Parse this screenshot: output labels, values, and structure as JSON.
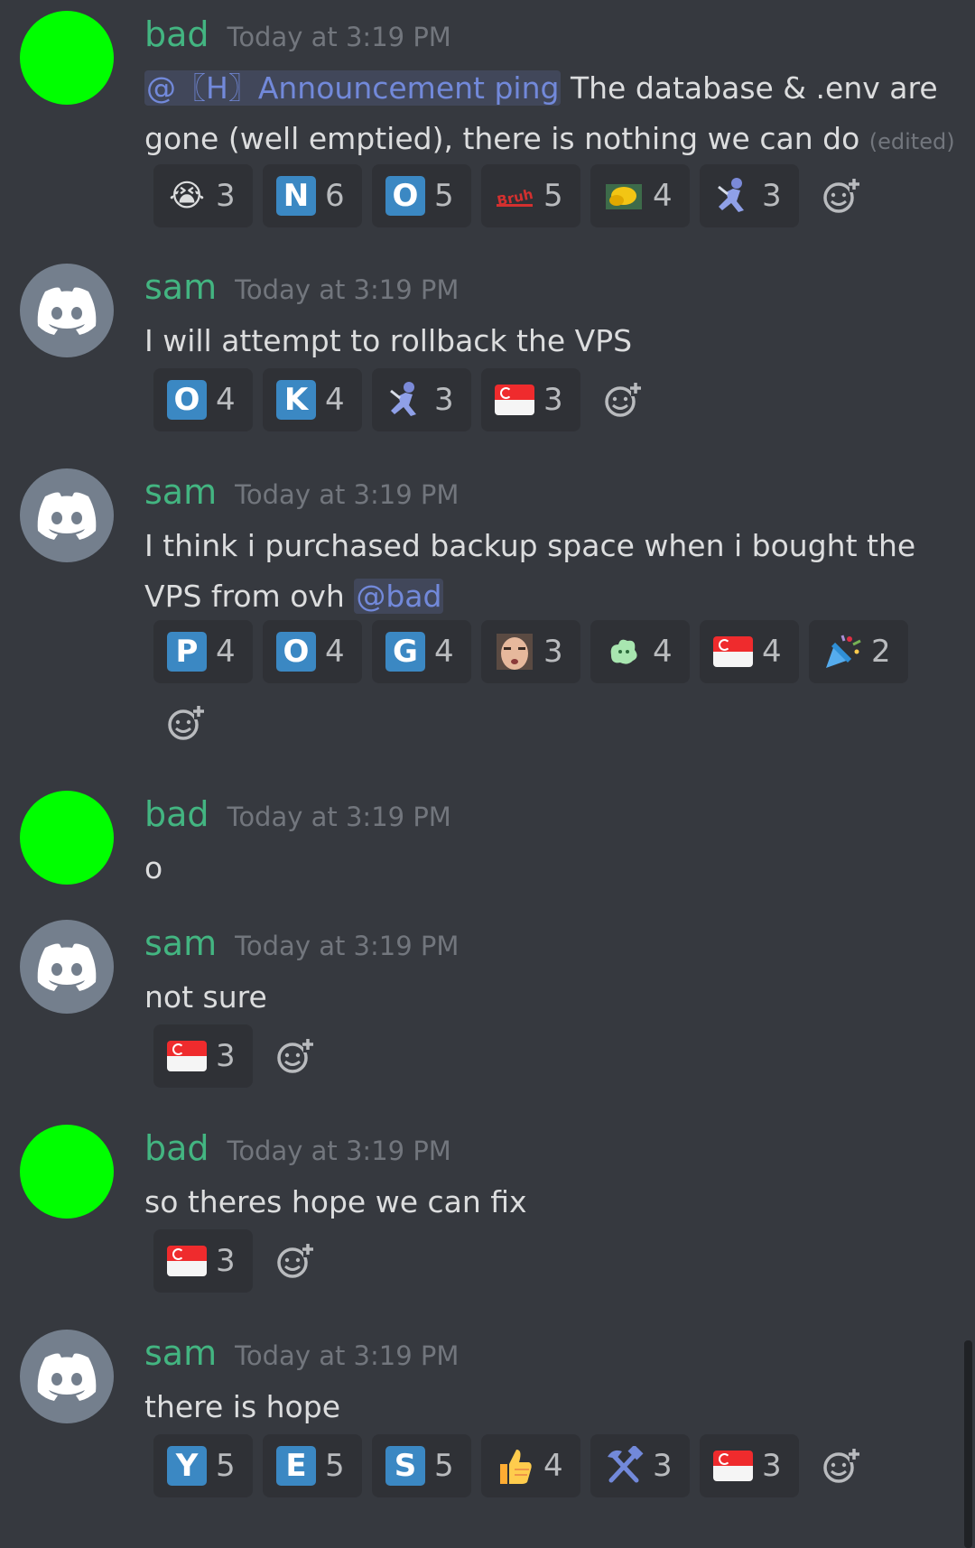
{
  "colors": {
    "background": "#36393f",
    "username": "#43b581",
    "timestamp": "#72767d",
    "mention": "#7289da",
    "reaction_bg": "#2f3136",
    "bad_avatar": "#00ff00",
    "sam_avatar": "#747f8d"
  },
  "messages": [
    {
      "author": "bad",
      "timestamp": "Today at 3:19 PM",
      "mention": "@〖H〗Announcement ping",
      "text": " The database & .env are gone (well emptied), there is nothing we can do",
      "edited": "(edited)",
      "reactions": [
        {
          "emoji": "sob-emoji",
          "glyph": "😭",
          "count": "3"
        },
        {
          "emoji": "regional-n",
          "glyph": "N",
          "count": "6"
        },
        {
          "emoji": "regional-o",
          "glyph": "O",
          "count": "5"
        },
        {
          "emoji": "bruh-emoji",
          "glyph": "Bruh",
          "count": "5"
        },
        {
          "emoji": "custom-yellow-emoji",
          "glyph": "",
          "count": "4"
        },
        {
          "emoji": "custom-dance-emoji",
          "glyph": "",
          "count": "3"
        }
      ]
    },
    {
      "author": "sam",
      "timestamp": "Today at 3:19 PM",
      "text": "I will attempt to rollback the VPS",
      "reactions": [
        {
          "emoji": "regional-o",
          "glyph": "O",
          "count": "4"
        },
        {
          "emoji": "regional-k",
          "glyph": "K",
          "count": "4"
        },
        {
          "emoji": "custom-dance-emoji",
          "glyph": "",
          "count": "3"
        },
        {
          "emoji": "flag-sg",
          "glyph": "",
          "count": "3"
        }
      ]
    },
    {
      "author": "sam",
      "timestamp": "Today at 3:19 PM",
      "text": "I think i purchased backup space when i bought the VPS from ovh ",
      "mention": "@bad",
      "reactions": [
        {
          "emoji": "regional-p",
          "glyph": "P",
          "count": "4"
        },
        {
          "emoji": "regional-o",
          "glyph": "O",
          "count": "4"
        },
        {
          "emoji": "regional-g",
          "glyph": "G",
          "count": "4"
        },
        {
          "emoji": "custom-face-emoji",
          "glyph": "",
          "count": "3"
        },
        {
          "emoji": "custom-green-emoji",
          "glyph": "",
          "count": "4"
        },
        {
          "emoji": "flag-sg",
          "glyph": "",
          "count": "4"
        },
        {
          "emoji": "tada-emoji",
          "glyph": "🎉",
          "count": "2"
        }
      ]
    },
    {
      "author": "bad",
      "timestamp": "Today at 3:19 PM",
      "text": "o",
      "reactions": []
    },
    {
      "author": "sam",
      "timestamp": "Today at 3:19 PM",
      "text": "not sure",
      "reactions": [
        {
          "emoji": "flag-sg",
          "glyph": "",
          "count": "3"
        }
      ]
    },
    {
      "author": "bad",
      "timestamp": "Today at 3:19 PM",
      "text": "so theres hope we can fix",
      "reactions": [
        {
          "emoji": "flag-sg",
          "glyph": "",
          "count": "3"
        }
      ]
    },
    {
      "author": "sam",
      "timestamp": "Today at 3:19 PM",
      "text": "there is hope",
      "reactions": [
        {
          "emoji": "regional-y",
          "glyph": "Y",
          "count": "5"
        },
        {
          "emoji": "regional-e",
          "glyph": "E",
          "count": "5"
        },
        {
          "emoji": "regional-s",
          "glyph": "S",
          "count": "5"
        },
        {
          "emoji": "thumbsup-emoji",
          "glyph": "👍",
          "count": "4"
        },
        {
          "emoji": "hammer-pick-emoji",
          "glyph": "⚒",
          "count": "3"
        },
        {
          "emoji": "flag-sg",
          "glyph": "",
          "count": "3"
        }
      ]
    }
  ]
}
